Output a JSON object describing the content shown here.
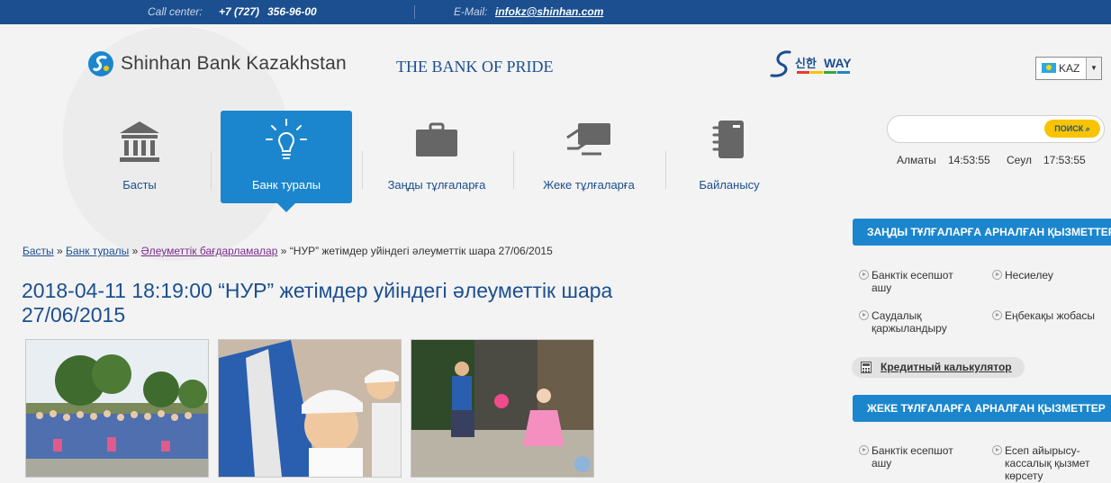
{
  "topbar": {
    "call_center_label": "Call center:",
    "phone_code": "+7 (727)",
    "phone_number": "356-96-00",
    "email_label": "E-Mail:",
    "email": "infokz@shinhan.com"
  },
  "header": {
    "logo_text": "Shinhan Bank Kazakhstan",
    "slogan": "THE BANK OF PRIDE",
    "way_logo_text": "WAY",
    "language": "KAZ"
  },
  "nav": {
    "items": [
      {
        "label": "Басты",
        "icon": "bank-building-icon"
      },
      {
        "label": "Банк туралы",
        "icon": "lightbulb-icon",
        "active": true
      },
      {
        "label": "Заңды тұлғаларға",
        "icon": "briefcase-icon"
      },
      {
        "label": "Жеке тұлғаларға",
        "icon": "card-in-hand-icon"
      },
      {
        "label": "Байланысу",
        "icon": "notebook-icon"
      }
    ]
  },
  "search": {
    "placeholder": "",
    "button_label": "ПОИСК"
  },
  "clocks": {
    "city1": "Алматы",
    "time1": "14:53:55",
    "city2": "Сеул",
    "time2": "17:53:55"
  },
  "breadcrumb": {
    "items": [
      "Басты",
      "Банк туралы",
      "Әлеуметтік бағдарламалар"
    ],
    "current": "“НУР” жетімдер уйіндегі әлеуметтік шара 27/06/2015",
    "separator": "»"
  },
  "article": {
    "title": "2018-04-11 18:19:00 “НУР” жетімдер уйіндегі әлеуметтік шара 27/06/2015"
  },
  "sidebar": {
    "legal_header": "ЗАҢДЫ ТҰЛҒАЛАРҒА АРНАЛҒАН ҚЫЗМЕТТЕР",
    "legal_links": [
      "Банктік есепшот ашу",
      "Несиелеу",
      "Саудалық қаржыландыру",
      "Еңбекақы жобасы"
    ],
    "calculator_label": "Кредитный калькулятор",
    "personal_header": "ЖЕКЕ ТҰЛҒАЛАРҒА АРНАЛҒАН ҚЫЗМЕТТЕР",
    "personal_links": [
      "Банктік есепшот ашу",
      "Есеп айырысу-кассалық қызмет көрсету"
    ]
  },
  "colors": {
    "topbar": "#1b4f8f",
    "accent": "#1b86cd",
    "search_button": "#f8c400"
  }
}
